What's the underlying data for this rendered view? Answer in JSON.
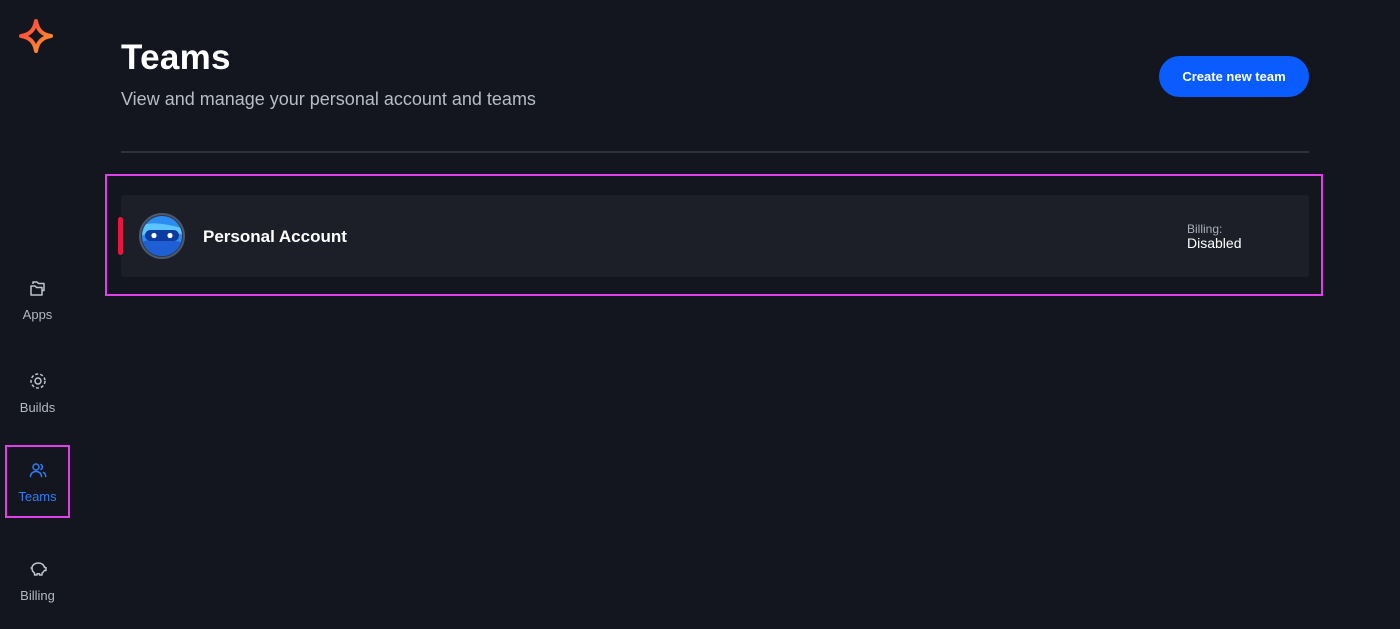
{
  "sidebar": {
    "logo": "sparkle-logo",
    "items": [
      {
        "label": "Apps",
        "icon": "folders-icon"
      },
      {
        "label": "Builds",
        "icon": "builds-icon"
      },
      {
        "label": "Teams",
        "icon": "users-icon",
        "active": true
      },
      {
        "label": "Billing",
        "icon": "piggy-bank-icon"
      }
    ]
  },
  "header": {
    "title": "Teams",
    "subtitle": "View and manage your personal account and teams",
    "create_button": "Create new team"
  },
  "teams": [
    {
      "name": "Personal Account",
      "avatar": "blue-avatar",
      "billing_label": "Billing:",
      "billing_status": "Disabled"
    }
  ],
  "colors": {
    "background": "#13161e",
    "card": "#1c1f28",
    "accent_blue": "#0a5cff",
    "active_nav": "#2f7df6",
    "team_accent": "#e8173f",
    "highlight": "#e040e8"
  }
}
